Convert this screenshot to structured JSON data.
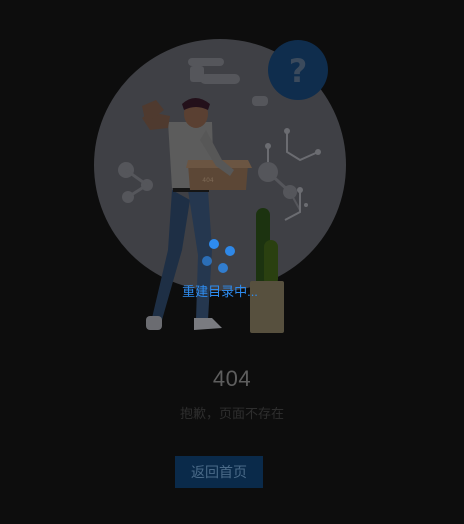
{
  "error": {
    "code": "404",
    "message": "抱歉，页面不存在",
    "back_button_label": "返回首页"
  },
  "illustration": {
    "question_mark": "?",
    "box_label": "404"
  },
  "loading": {
    "text": "重建目录中..."
  },
  "colors": {
    "background": "#0d0d0d",
    "accent": "#2e8cf0",
    "button_bg": "#0a2a4a"
  }
}
